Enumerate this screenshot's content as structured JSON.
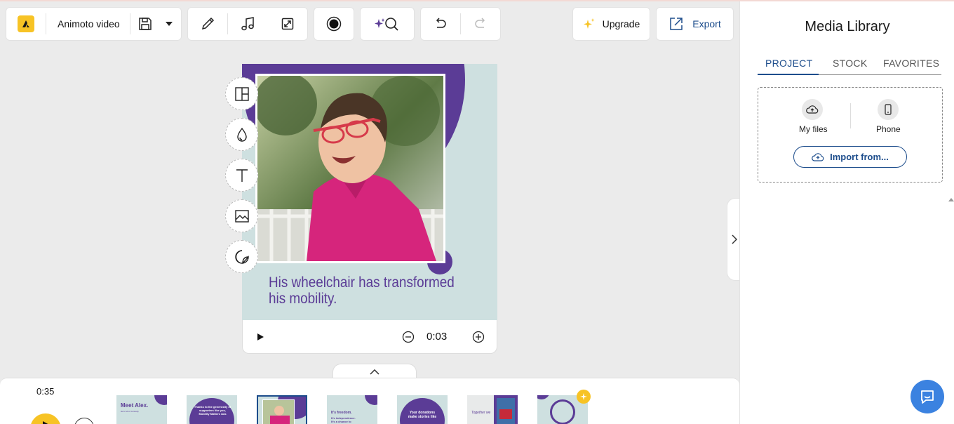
{
  "toolbar": {
    "project_name": "Animoto video",
    "upgrade_label": "Upgrade",
    "export_label": "Export",
    "icons": [
      "animoto-logo-icon",
      "save-icon",
      "chevron-down-icon",
      "pencil-icon",
      "music-note-icon",
      "resize-icon",
      "record-icon",
      "ai-search-icon",
      "undo-icon",
      "redo-icon",
      "sparkle-icon",
      "export-icon"
    ]
  },
  "canvas": {
    "caption_line1": "His wheelchair has transformed",
    "caption_line2": "his mobility.",
    "tools": [
      "layout-icon",
      "color-drop-icon",
      "text-icon",
      "image-icon",
      "sticker-icon"
    ]
  },
  "player": {
    "time": "0:03"
  },
  "timeline": {
    "total_time": "0:35",
    "thumbnails": [
      {
        "title": "Meet Alex.",
        "body": "He's full of curiosity"
      },
      {
        "title": "",
        "body": "Thanks to the generosity of supporters like you, Mobility Matters was"
      },
      {
        "title": "",
        "body": ""
      },
      {
        "title": "It's freedom.",
        "body": "It's independence. It's a chance to explore."
      },
      {
        "title": "",
        "body": "Your donations make stories like"
      },
      {
        "title": "",
        "body": "Together we"
      },
      {
        "title": "",
        "body": ""
      }
    ]
  },
  "media_library": {
    "title": "Media Library",
    "tabs": [
      "PROJECT",
      "STOCK",
      "FAVORITES"
    ],
    "active_tab": "PROJECT",
    "my_files_label": "My files",
    "phone_label": "Phone",
    "import_label": "Import from..."
  },
  "colors": {
    "accent_yellow": "#f7c325",
    "purple": "#5b3c96",
    "teal_bg": "#cee0e0",
    "link_blue": "#1d4d8c",
    "photo_pink": "#d6257c"
  }
}
